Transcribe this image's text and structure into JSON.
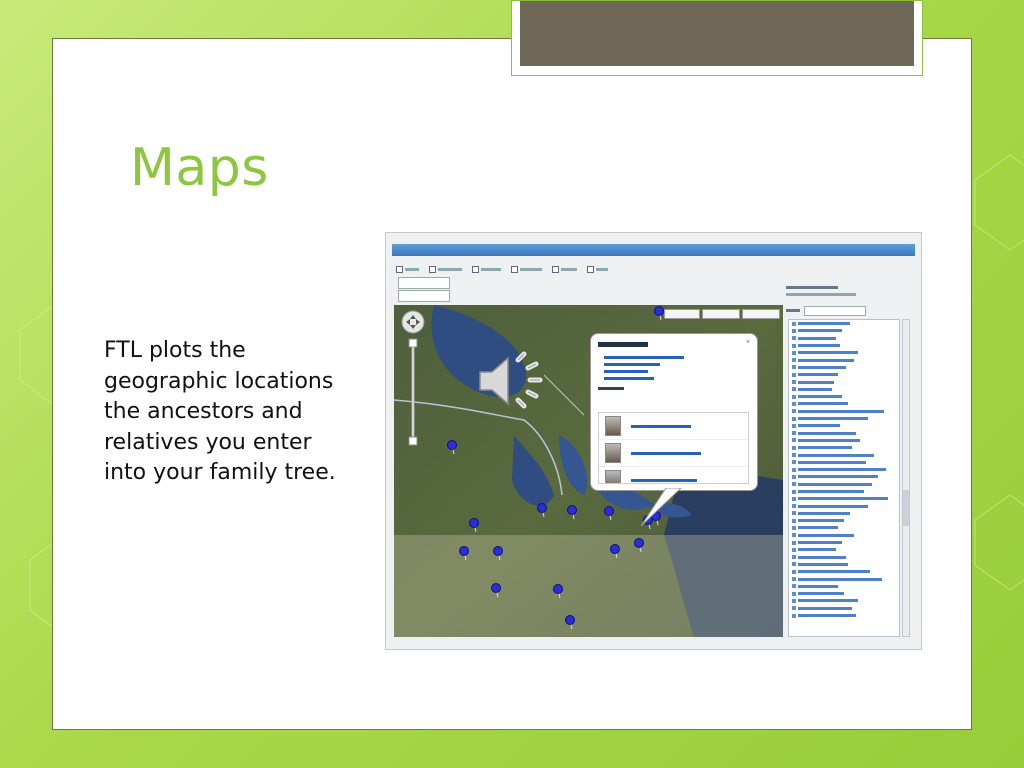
{
  "slide": {
    "title": "Maps",
    "body": "FTL plots the geographic locations the ancestors and relatives you enter into your family tree."
  },
  "colors": {
    "background": "#a9d94a",
    "title": "#8dc63f",
    "tab_fill": "#6f6858",
    "popup_link": "#2563b8"
  },
  "audio": {
    "icon": "speaker-icon"
  }
}
